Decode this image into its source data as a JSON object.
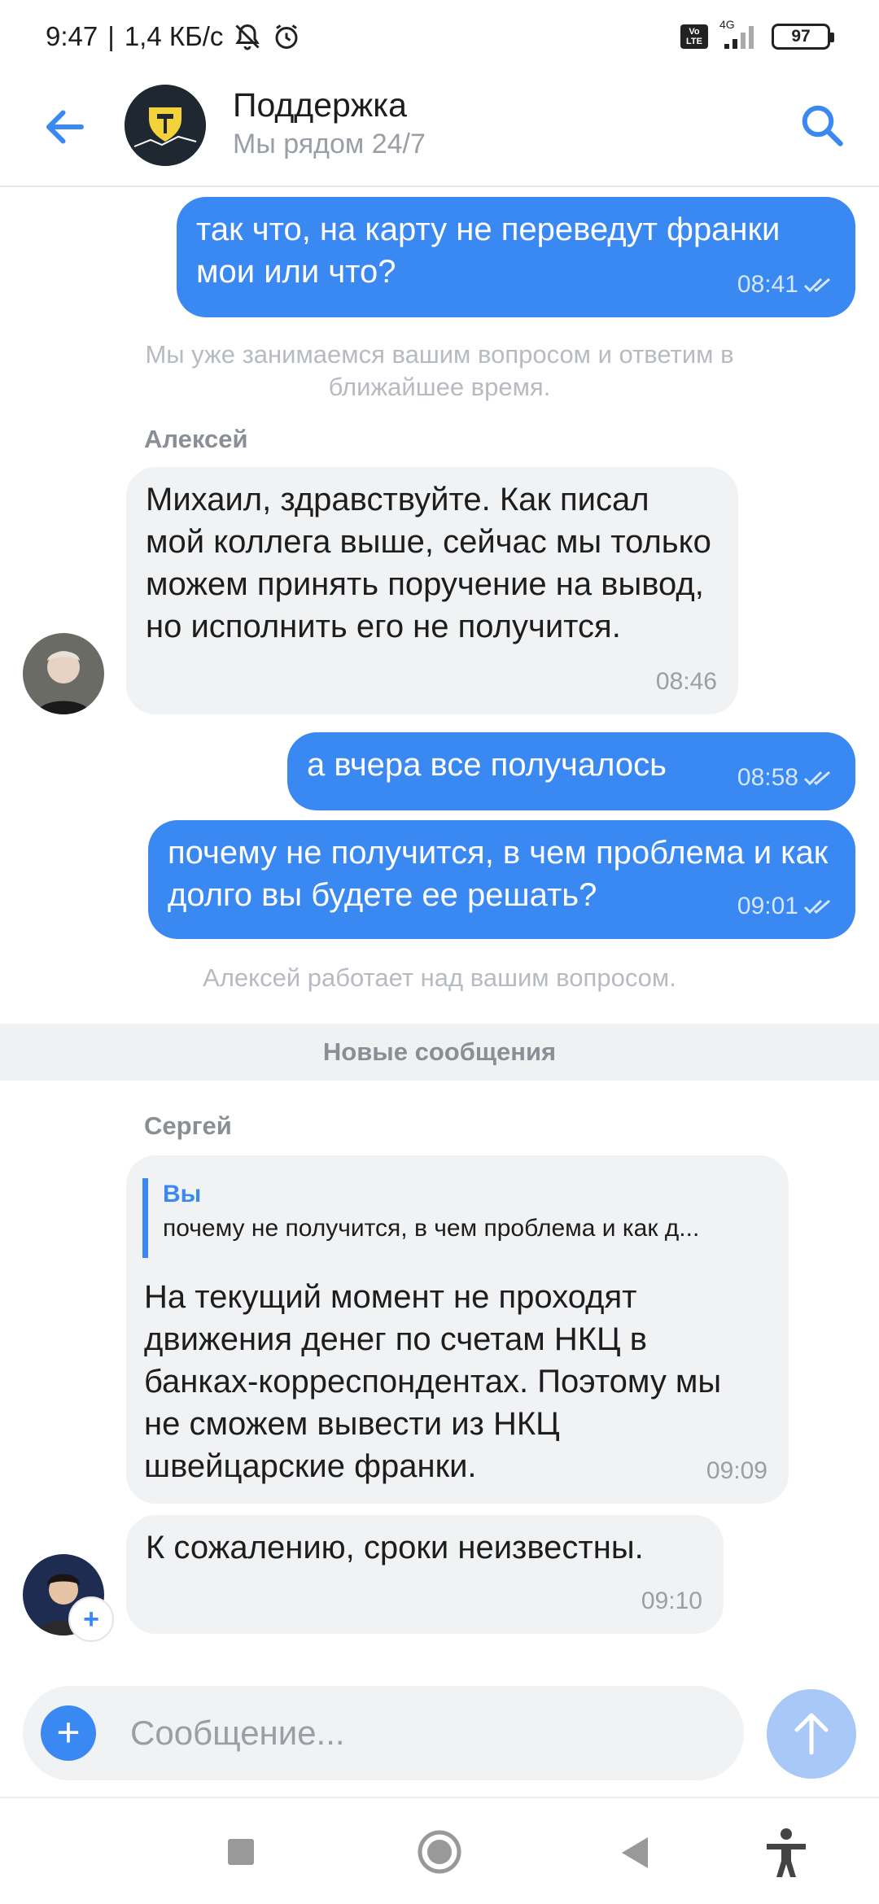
{
  "status_bar": {
    "time": "9:47",
    "speed": "1,4 КБ/с",
    "network": "4G",
    "volte": "Vo LTE",
    "battery": "97"
  },
  "header": {
    "title": "Поддержка",
    "subtitle": "Мы рядом 24/7"
  },
  "messages": {
    "m1": {
      "text": "так что, на карту не переведут франки мои или что?",
      "time": "08:41"
    },
    "sys1": "Мы уже занимаемся вашим вопросом и ответим в ближайшее время.",
    "sender1": "Алексей",
    "m2": {
      "text": "Михаил, здравствуйте. Как писал мой коллега выше, сейчас мы только можем принять поручение на вывод, но исполнить его не получится.",
      "time": "08:46"
    },
    "m3": {
      "text": "а вчера все получалось",
      "time": "08:58"
    },
    "m4": {
      "text": "почему не получится, в чем проблема и как долго вы будете ее решать?",
      "time": "09:01"
    },
    "sys2": "Алексей работает над вашим вопросом.",
    "new_divider": "Новые сообщения",
    "sender2": "Сергей",
    "m5": {
      "reply_name": "Вы",
      "reply_text": "почему не получится, в чем проблема и как д...",
      "text": "На текущий момент не проходят движения денег по счетам НКЦ в банках-корреспондентах. Поэтому мы не сможем вывести из НКЦ швейцарские франки.",
      "time": "09:09"
    },
    "m6": {
      "text": "К сожалению, сроки неизвестны.",
      "time": "09:10"
    }
  },
  "composer": {
    "placeholder": "Сообщение..."
  },
  "colors": {
    "accent": "#3a88f2",
    "incoming": "#f1f2f4",
    "send_disabled": "#a8c8f8"
  }
}
